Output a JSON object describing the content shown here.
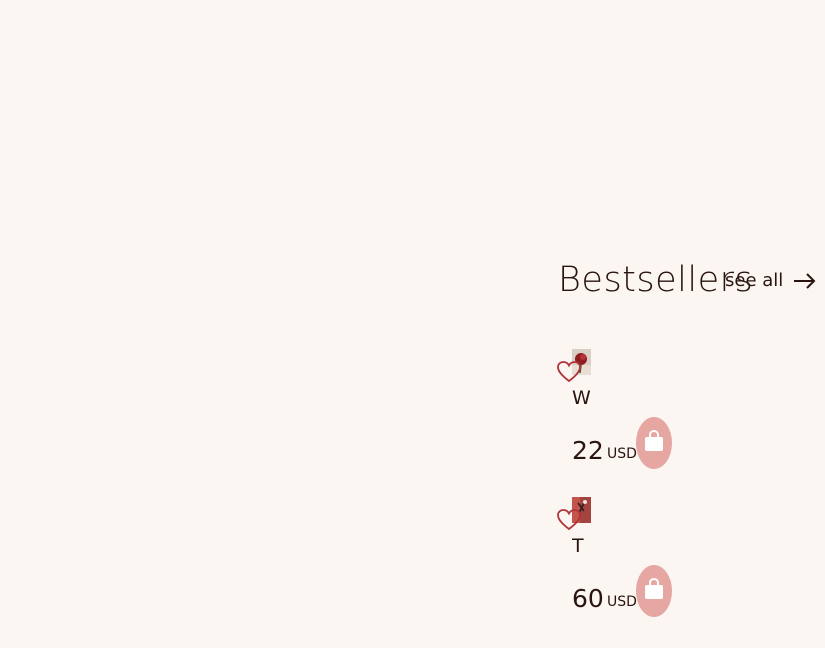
{
  "bestsellers": {
    "title": "Bestsellers",
    "see_all_label": "see all",
    "products": [
      {
        "name": "W",
        "price": "22",
        "currency": "USD"
      },
      {
        "name": "T",
        "price": "60",
        "currency": "USD"
      }
    ]
  },
  "colors": {
    "background": "#fbf6f1",
    "heart_outline": "#b0343a",
    "cart_button": "#e6a6a2",
    "text": "#2a140f"
  },
  "icons": {
    "favorite": "heart-icon",
    "cart": "shopping-bag-icon",
    "see_all": "arrow-right-icon"
  }
}
